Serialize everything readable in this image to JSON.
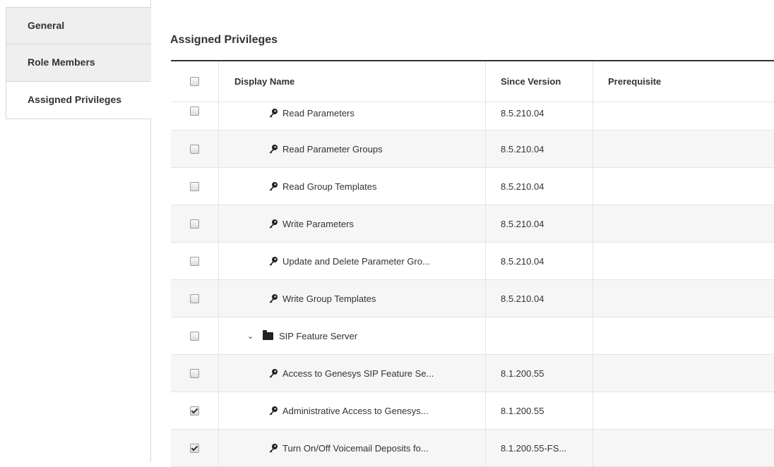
{
  "sidebar": {
    "tabs": [
      {
        "label": "General"
      },
      {
        "label": "Role Members"
      },
      {
        "label": "Assigned Privileges"
      }
    ]
  },
  "section": {
    "title": "Assigned Privileges"
  },
  "table": {
    "columns": [
      "Display Name",
      "Since Version",
      "Prerequisite"
    ],
    "rows": [
      {
        "name": "Read Parameters",
        "version": "8.5.210.04",
        "prerequisite": "",
        "checked": false
      },
      {
        "name": "Read Parameter Groups",
        "version": "8.5.210.04",
        "prerequisite": "",
        "checked": false
      },
      {
        "name": "Read Group Templates",
        "version": "8.5.210.04",
        "prerequisite": "",
        "checked": false
      },
      {
        "name": "Write Parameters",
        "version": "8.5.210.04",
        "prerequisite": "",
        "checked": false
      },
      {
        "name": "Update and Delete Parameter Gro...",
        "version": "8.5.210.04",
        "prerequisite": "",
        "checked": false
      },
      {
        "name": "Write Group Templates",
        "version": "8.5.210.04",
        "prerequisite": "",
        "checked": false
      },
      {
        "name": "SIP Feature Server",
        "version": "",
        "prerequisite": "",
        "checked": false
      },
      {
        "name": "Access to Genesys SIP Feature Se...",
        "version": "8.1.200.55",
        "prerequisite": "",
        "checked": false
      },
      {
        "name": "Administrative Access to Genesys...",
        "version": "8.1.200.55",
        "prerequisite": "",
        "checked": true
      },
      {
        "name": "Turn On/Off Voicemail Deposits fo...",
        "version": "8.1.200.55-FS...",
        "prerequisite": "",
        "checked": true
      }
    ]
  },
  "icons": {
    "privilege": "key-icon",
    "group": "folder-icon",
    "expand": "chevron-down-icon"
  }
}
